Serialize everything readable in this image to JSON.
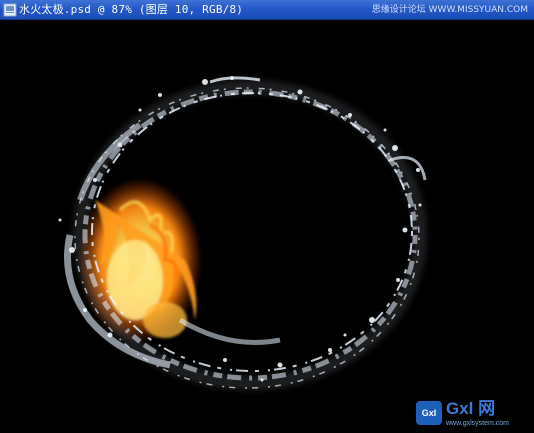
{
  "window": {
    "title": "水火太极.psd @ 87% (图层 10, RGB/8)",
    "site_watermark": "思缘设计论坛 WWW.MISSYUAN.COM"
  },
  "logo": {
    "badge": "Gxl",
    "name": "Gxl 网",
    "url": "www.gxlsystem.com"
  },
  "icons": {
    "document": "document-icon"
  },
  "colors": {
    "titlebar": "#2458c8",
    "canvas": "#000000",
    "logo_blue": "#3a7ad8"
  }
}
